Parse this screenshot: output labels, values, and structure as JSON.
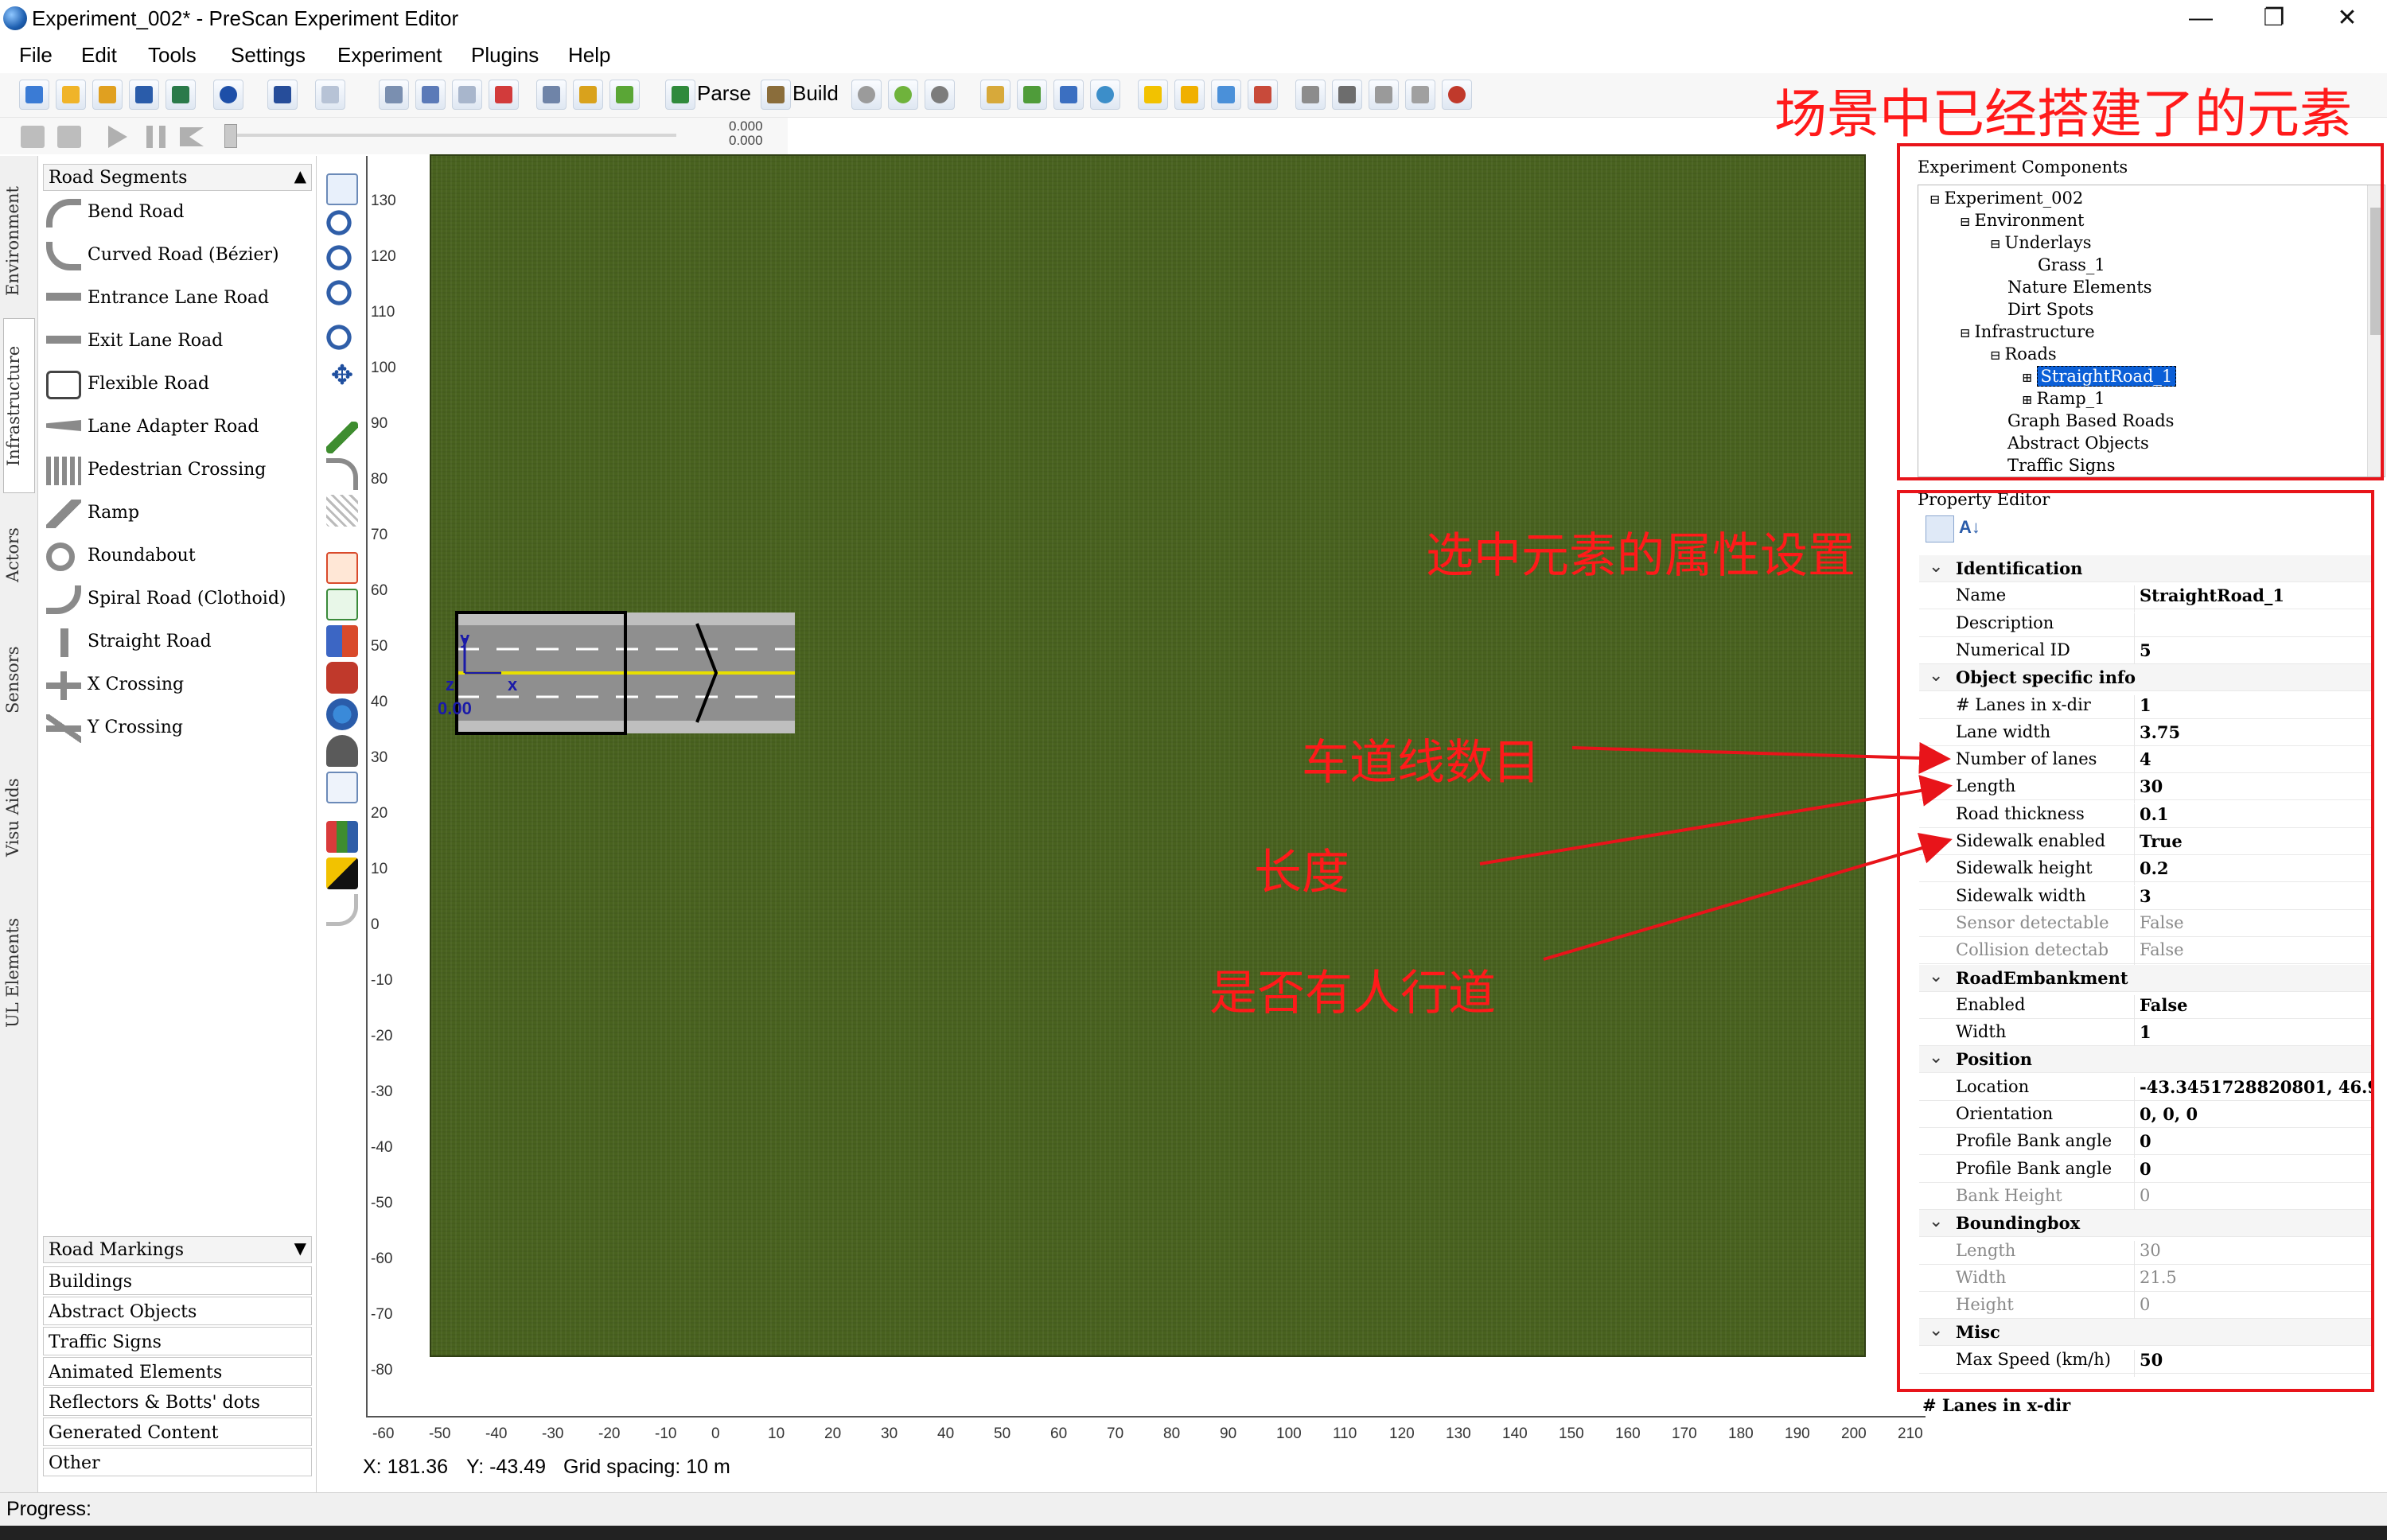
{
  "window": {
    "title": "Experiment_002* - PreScan Experiment Editor",
    "minimize": "—",
    "restore": "❐",
    "close": "✕"
  },
  "menu": [
    "File",
    "Edit",
    "Tools",
    "Settings",
    "Experiment",
    "Plugins",
    "Help"
  ],
  "toolbar": {
    "parse": "Parse",
    "build": "Build",
    "sim_top": "0.000",
    "sim_bottom": "0.000"
  },
  "side_tabs": [
    "Environment",
    "Infrastructure",
    "Actors",
    "Sensors",
    "Visu Aids",
    "UL Elements"
  ],
  "library": {
    "header": "Road Segments",
    "items": [
      "Bend Road",
      "Curved Road (Bézier)",
      "Entrance Lane Road",
      "Exit Lane Road",
      "Flexible Road",
      "Lane Adapter Road",
      "Pedestrian Crossing",
      "Ramp",
      "Roundabout",
      "Spiral Road (Clothoid)",
      "Straight Road",
      "X Crossing",
      "Y Crossing"
    ],
    "categories": [
      "Road Markings",
      "Buildings",
      "Abstract Objects",
      "Traffic Signs",
      "Animated Elements",
      "Reflectors & Botts' dots",
      "Generated Content",
      "Other"
    ]
  },
  "ruler": {
    "vertical": [
      "130",
      "120",
      "110",
      "100",
      "90",
      "80",
      "70",
      "60",
      "50",
      "40",
      "30",
      "20",
      "10",
      "0",
      "-10",
      "-20",
      "-30",
      "-40",
      "-50",
      "-60",
      "-70",
      "-80"
    ],
    "horizontal": [
      "-60",
      "-50",
      "-40",
      "-30",
      "-20",
      "-10",
      "0",
      "10",
      "20",
      "30",
      "40",
      "50",
      "60",
      "70",
      "80",
      "90",
      "100",
      "110",
      "120",
      "130",
      "140",
      "150",
      "160",
      "170",
      "180",
      "190",
      "200",
      "210"
    ]
  },
  "canvas": {
    "origin_label": "0.00",
    "axis_x": "x",
    "axis_y": "y",
    "axis_z": "z"
  },
  "status": {
    "x": "X: 181.36",
    "y": "Y: -43.49",
    "grid": "Grid spacing: 10 m",
    "progress": "Progress:"
  },
  "experiment_components": {
    "title": "Experiment Components",
    "nodes": [
      "Experiment_002",
      "Environment",
      "Underlays",
      "Grass_1",
      "Nature Elements",
      "Dirt Spots",
      "Infrastructure",
      "Roads",
      "StraightRoad_1",
      "Ramp_1",
      "Graph Based Roads",
      "Abstract Objects",
      "Traffic Signs"
    ]
  },
  "property_editor": {
    "title": "Property Editor",
    "footer": "# Lanes in x-dir",
    "rows": [
      {
        "k": "Identification",
        "cat": true
      },
      {
        "k": "Name",
        "v": "StraightRoad_1"
      },
      {
        "k": "Description",
        "v": ""
      },
      {
        "k": "Numerical ID",
        "v": "5"
      },
      {
        "k": "Object specific info",
        "cat": true
      },
      {
        "k": "# Lanes in x-dir",
        "v": "1"
      },
      {
        "k": "Lane width",
        "v": "3.75"
      },
      {
        "k": "Number of lanes",
        "v": "4"
      },
      {
        "k": "Length",
        "v": "30"
      },
      {
        "k": "Road thickness",
        "v": "0.1"
      },
      {
        "k": "Sidewalk enabled",
        "v": "True"
      },
      {
        "k": "Sidewalk height",
        "v": "0.2"
      },
      {
        "k": "Sidewalk width",
        "v": "3"
      },
      {
        "k": "Sensor detectable",
        "v": "False",
        "dim": true
      },
      {
        "k": "Collision detectab",
        "v": "False",
        "dim": true
      },
      {
        "k": "RoadEmbankment",
        "cat": true
      },
      {
        "k": "Enabled",
        "v": "False"
      },
      {
        "k": "Width",
        "v": "1"
      },
      {
        "k": "Position",
        "cat": true
      },
      {
        "k": "Location",
        "v": "-43.3451728820801, 46.9"
      },
      {
        "k": "Orientation",
        "v": "0, 0, 0"
      },
      {
        "k": "Profile Bank angle",
        "v": "0"
      },
      {
        "k": "Profile Bank angle",
        "v": "0"
      },
      {
        "k": "Bank Height",
        "v": "0",
        "dim": true
      },
      {
        "k": "Boundingbox",
        "cat": true
      },
      {
        "k": "Length",
        "v": "30",
        "dim": true
      },
      {
        "k": "Width",
        "v": "21.5",
        "dim": true
      },
      {
        "k": "Height",
        "v": "0",
        "dim": true
      },
      {
        "k": "Misc",
        "cat": true
      },
      {
        "k": "Max Speed (km/h)",
        "v": "50"
      }
    ]
  },
  "annotations": {
    "components": "场景中已经搭建了的元素",
    "properties": "选中元素的属性设置",
    "lanes": "车道线数目",
    "length": "长度",
    "sidewalk": "是否有人行道"
  },
  "colors": {
    "annotation": "#e8141a",
    "grass": "#49621f",
    "selection": "#0b5fd7"
  }
}
